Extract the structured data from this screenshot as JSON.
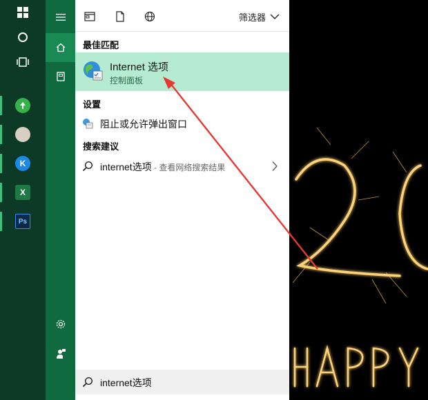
{
  "toolbar": {
    "filter_label": "筛选器"
  },
  "best_match": {
    "heading": "最佳匹配",
    "title": "Internet 选项",
    "subtitle": "控制面板"
  },
  "settings": {
    "heading": "设置",
    "item": "阻止或允许弹出窗口"
  },
  "suggestions": {
    "heading": "搜索建议",
    "query": "internet选项",
    "hint": " - 查看网络搜索结果"
  },
  "search": {
    "value": "internet选项"
  },
  "taskbar_apps": [
    {
      "icon": "green-sync-app-icon",
      "letter": ""
    },
    {
      "icon": "photo-app-icon",
      "letter": ""
    },
    {
      "icon": "k-app-icon",
      "letter": "K"
    },
    {
      "icon": "excel-app-icon",
      "letter": "X"
    },
    {
      "icon": "photoshop-app-icon",
      "letter": "Ps"
    }
  ],
  "colors": {
    "taskbar_bg": "#0c3a26",
    "rail_bg": "#0f6b3f",
    "highlight": "#b5ecd1",
    "arrow": "#e53935"
  }
}
